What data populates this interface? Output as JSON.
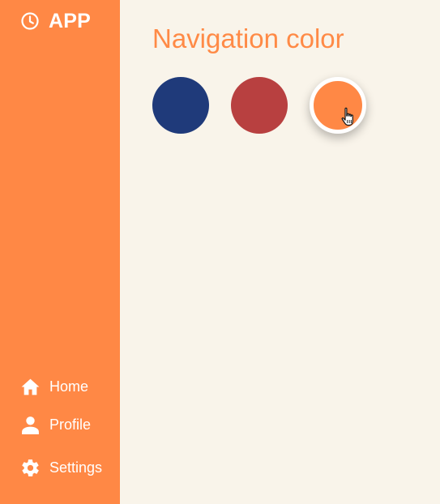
{
  "app": {
    "brand_label": "APP",
    "brand_icon": "clock-icon"
  },
  "sidebar": {
    "background": "#ff8845",
    "items": [
      {
        "label": "Home",
        "icon": "home-icon"
      },
      {
        "label": "Profile",
        "icon": "user-icon"
      },
      {
        "label": "Settings",
        "icon": "gear-icon"
      }
    ]
  },
  "main": {
    "title": "Navigation color",
    "title_color": "#ff8a46",
    "background": "#f9f4ea",
    "swatches": [
      {
        "color": "#1f3a7a",
        "selected": false
      },
      {
        "color": "#b84040",
        "selected": false
      },
      {
        "color": "#ff8845",
        "selected": true
      }
    ]
  }
}
